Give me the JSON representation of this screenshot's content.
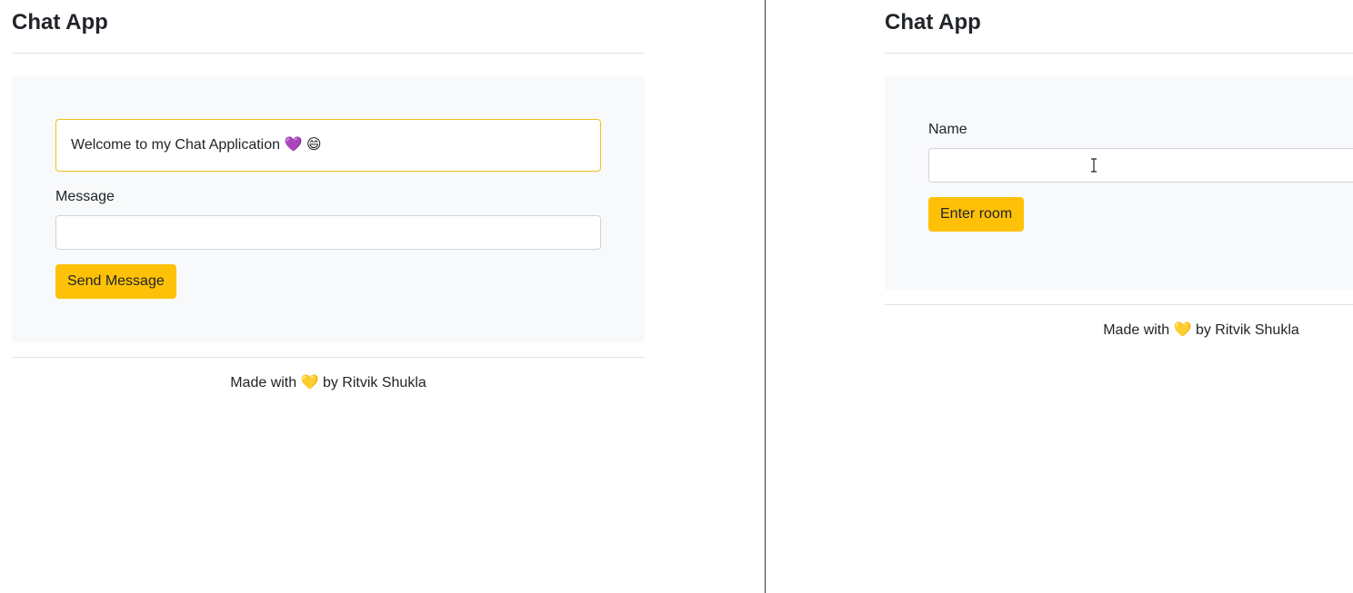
{
  "left": {
    "app_title": "Chat App",
    "welcome_text": "Welcome to my Chat Application 💜 😄",
    "message_label": "Message",
    "message_value": "",
    "send_button_label": "Send Message",
    "footer_text": "Made with 💛 by Ritvik Shukla"
  },
  "right": {
    "app_title": "Chat App",
    "name_label": "Name",
    "name_value": "",
    "enter_button_label": "Enter room",
    "footer_text": "Made with 💛 by Ritvik Shukla"
  },
  "colors": {
    "accent": "#ffc107",
    "panel_bg": "#f8f9fa",
    "alert_border": "#f0c020",
    "divider": "#3a3a3a"
  }
}
